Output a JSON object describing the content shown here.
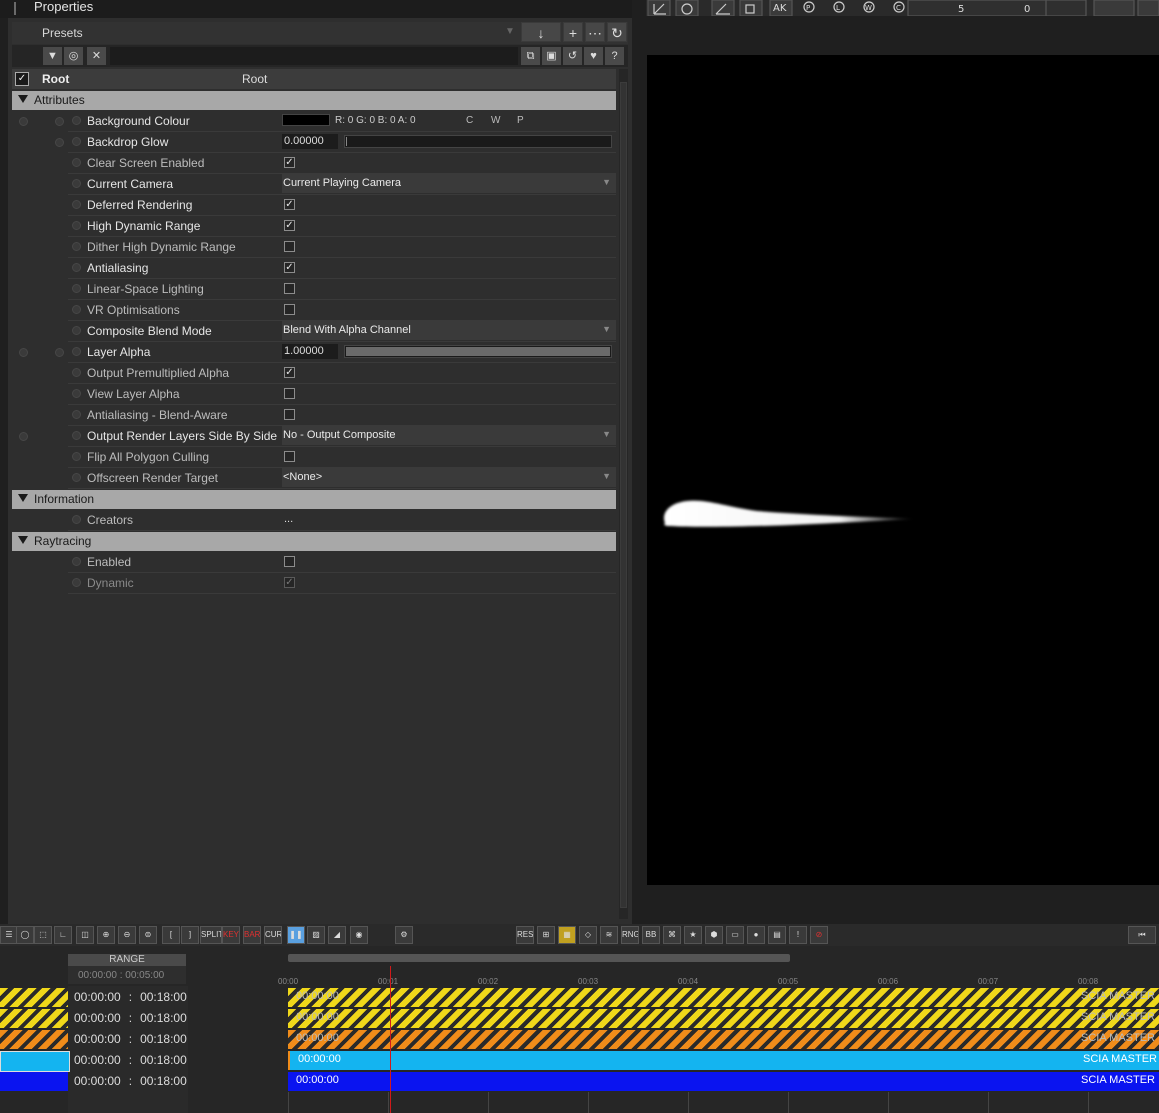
{
  "panel": {
    "title": "Properties",
    "presets_label": "Presets",
    "root": {
      "label": "Root",
      "value": "Root",
      "checked": "✓"
    }
  },
  "sections": {
    "attributes": "Attributes",
    "information": "Information",
    "raytracing": "Raytracing"
  },
  "attributes": [
    {
      "name": "Background Colour",
      "type": "color",
      "value": "R: 0 G: 0 B: 0 A: 0",
      "swatch": "#000000",
      "btn_c": "C",
      "btn_w": "W",
      "btn_p": "P"
    },
    {
      "name": "Backdrop Glow",
      "type": "number",
      "value": "0.00000",
      "fill": 0.0
    },
    {
      "name": "Clear Screen Enabled",
      "type": "check",
      "checked": true
    },
    {
      "name": "Current Camera",
      "type": "dropdown",
      "value": "Current Playing Camera"
    },
    {
      "name": "Deferred Rendering",
      "type": "check",
      "checked": true
    },
    {
      "name": "High Dynamic Range",
      "type": "check",
      "checked": true
    },
    {
      "name": "Dither High Dynamic Range",
      "type": "check",
      "checked": false
    },
    {
      "name": "Antialiasing",
      "type": "check",
      "checked": true
    },
    {
      "name": "Linear-Space Lighting",
      "type": "check",
      "checked": false
    },
    {
      "name": "VR Optimisations",
      "type": "check",
      "checked": false
    },
    {
      "name": "Composite Blend Mode",
      "type": "dropdown",
      "value": "Blend With Alpha Channel"
    },
    {
      "name": "Layer Alpha",
      "type": "number",
      "value": "1.00000",
      "fill": 1.0
    },
    {
      "name": "Output Premultiplied Alpha",
      "type": "check",
      "checked": true
    },
    {
      "name": "View Layer Alpha",
      "type": "check",
      "checked": false
    },
    {
      "name": "Antialiasing - Blend-Aware",
      "type": "check",
      "checked": false
    },
    {
      "name": "Output Render Layers Side By Side",
      "type": "dropdown",
      "value": "No - Output Composite"
    },
    {
      "name": "Flip All Polygon Culling",
      "type": "check",
      "checked": false
    },
    {
      "name": "Offscreen Render Target",
      "type": "dropdown",
      "value": "<None>"
    }
  ],
  "information": [
    {
      "name": "Creators",
      "value": "..."
    }
  ],
  "raytracing": [
    {
      "name": "Enabled",
      "checked": false
    },
    {
      "name": "Dynamic",
      "checked": true,
      "disabled": true
    }
  ],
  "toolbar_labels": {
    "split": "SPLIT",
    "key": "KEY",
    "bar": "BAR",
    "cur": "CUR",
    "res": "RES",
    "rng": "RNG",
    "bb": "BB"
  },
  "timeline": {
    "range_label": "RANGE",
    "range_start": "00:00:00",
    "range_sep": ":",
    "range_end": "00:05:00",
    "ticks": [
      "00:00",
      "00:01",
      "00:02",
      "00:03",
      "00:04",
      "00:05",
      "00:06",
      "00:07",
      "00:08"
    ],
    "rows": [
      {
        "start": "00:00:00",
        "end": "00:18:00",
        "style": "yellow",
        "label": "00:00:00",
        "right": "SCIA  MASTER"
      },
      {
        "start": "00:00:00",
        "end": "00:18:00",
        "style": "yellow",
        "label": "00:00:00",
        "right": "SCIA  MASTER"
      },
      {
        "start": "00:00:00",
        "end": "00:18:00",
        "style": "orange",
        "label": "00:00:00",
        "right": "SCIA  MASTER"
      },
      {
        "start": "00:00:00",
        "end": "00:18:00",
        "style": "cyan",
        "label": "00:00:00",
        "right": "SCIA  MASTER"
      },
      {
        "start": "00:00:00",
        "end": "00:18:00",
        "style": "blue",
        "label": "00:00:00",
        "right": "SCIA  MASTER"
      }
    ],
    "colors": {
      "cyan": "#14b4f0",
      "blue": "#0a14f0",
      "yellow": "#f0d81a",
      "orange": "#f08c1a",
      "playhead": "#d01a1a"
    }
  }
}
